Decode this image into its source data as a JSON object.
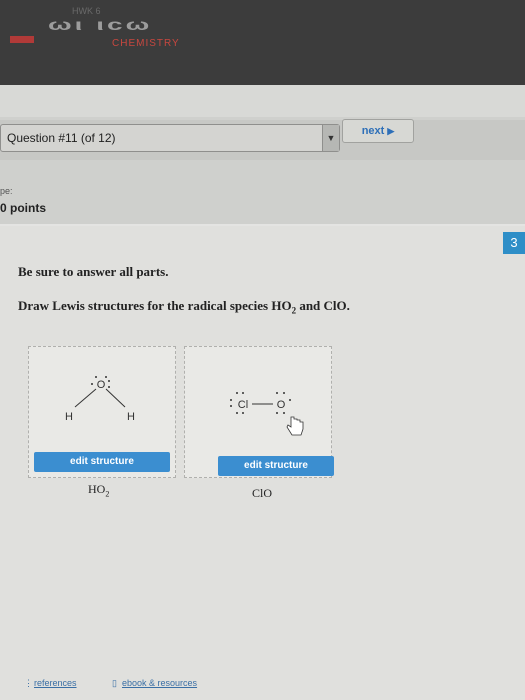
{
  "header": {
    "tab": "HWK 6",
    "brand_mark": "ωι ιcω",
    "brand_sub": "CHEMISTRY"
  },
  "question": {
    "selector_text": "Question #11 (of 12)",
    "next_label": "next",
    "points_label": "ре:",
    "points_text": "0 points",
    "part_badge": "3"
  },
  "body": {
    "instruction1": "Be sure to answer all parts.",
    "instruction2_pre": "Draw Lewis structures for the radical species HO",
    "instruction2_sub": "2",
    "instruction2_post": " and ClO."
  },
  "structures": [
    {
      "edit_label": "edit structure",
      "name_main": "HO",
      "name_sub": "2",
      "atoms": [
        "O",
        "H",
        "H"
      ]
    },
    {
      "edit_label": "edit structure",
      "name_main": "ClO",
      "name_sub": "",
      "atoms": [
        "Cl",
        "O"
      ]
    }
  ],
  "footer": {
    "references": "references",
    "ebook": "ebook & resources"
  },
  "colors": {
    "accent": "#3b8ed0",
    "badge": "#2e8ec7",
    "brand": "#c7473f"
  }
}
